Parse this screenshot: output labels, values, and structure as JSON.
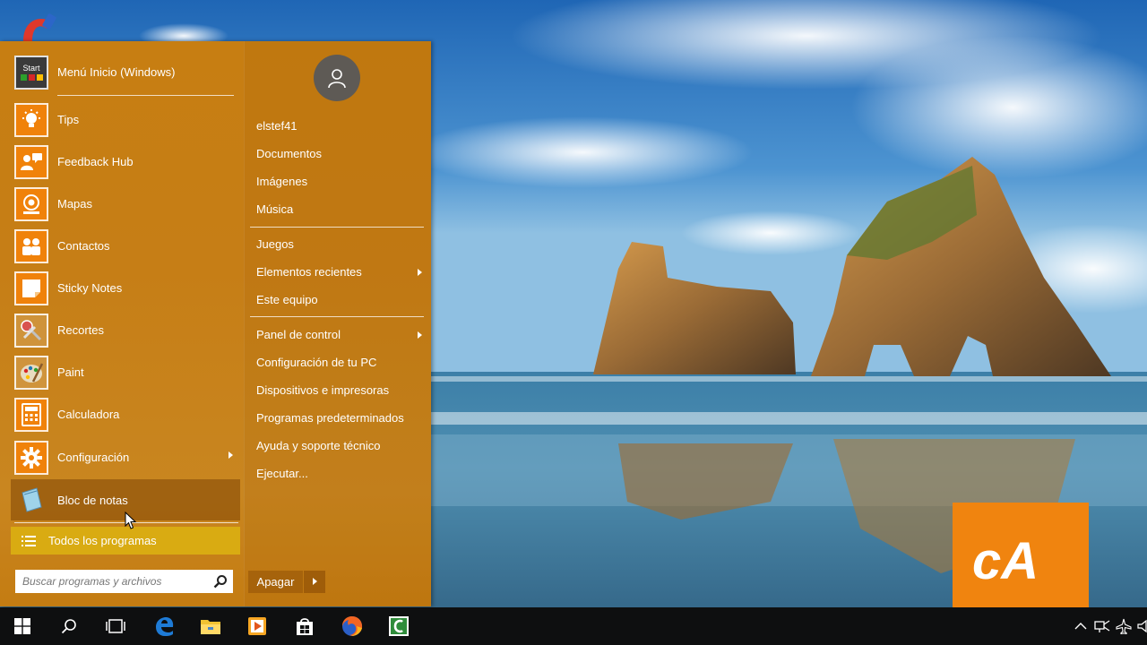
{
  "start_menu": {
    "header": {
      "label": "Menú Inicio (Windows)",
      "icon": "start-menu-app-icon",
      "icon_text": "Start"
    },
    "programs": [
      {
        "label": "Tips",
        "icon": "lightbulb-icon"
      },
      {
        "label": "Feedback Hub",
        "icon": "feedback-icon"
      },
      {
        "label": "Mapas",
        "icon": "maps-icon"
      },
      {
        "label": "Contactos",
        "icon": "people-icon"
      },
      {
        "label": "Sticky Notes",
        "icon": "sticky-note-icon"
      },
      {
        "label": "Recortes",
        "icon": "scissors-icon"
      },
      {
        "label": "Paint",
        "icon": "palette-icon"
      },
      {
        "label": "Calculadora",
        "icon": "calculator-icon"
      },
      {
        "label": "Configuración",
        "icon": "gear-icon",
        "has_submenu": true
      },
      {
        "label": "Bloc de notas",
        "icon": "notepad-icon",
        "active": true
      }
    ],
    "all_programs_label": "Todos los programas",
    "search_placeholder": "Buscar programas y archivos",
    "user": {
      "name": "elstef41",
      "avatar_icon": "user-avatar-icon"
    },
    "places": [
      {
        "label": "Documentos"
      },
      {
        "label": "Imágenes"
      },
      {
        "label": "Música"
      },
      {
        "label": "Juegos"
      },
      {
        "label": "Elementos recientes",
        "has_submenu": true
      },
      {
        "label": "Este equipo"
      },
      {
        "label": "Panel de control",
        "has_submenu": true
      },
      {
        "label": "Configuración de tu PC"
      },
      {
        "label": "Dispositivos e impresoras"
      },
      {
        "label": "Programas predeterminados"
      },
      {
        "label": "Ayuda y soporte técnico"
      },
      {
        "label": "Ejecutar..."
      }
    ],
    "shutdown_label": "Apagar"
  },
  "taskbar": {
    "apps": [
      "windows-start-icon",
      "search-icon",
      "task-view-icon",
      "edge-icon",
      "file-explorer-icon",
      "media-player-icon",
      "store-icon",
      "firefox-icon",
      "camtasia-icon"
    ],
    "tray": [
      "chevron-up-icon",
      "network-icon",
      "airplane-icon",
      "volume-icon"
    ]
  },
  "watermark": {
    "text": "cA"
  },
  "colors": {
    "menu_bg": "#c77e12",
    "all_programs_bg": "#d9ab12",
    "icon_orange": "#f0820a",
    "logo_bg": "#f0840f",
    "taskbar_bg": "#0e0f10"
  }
}
